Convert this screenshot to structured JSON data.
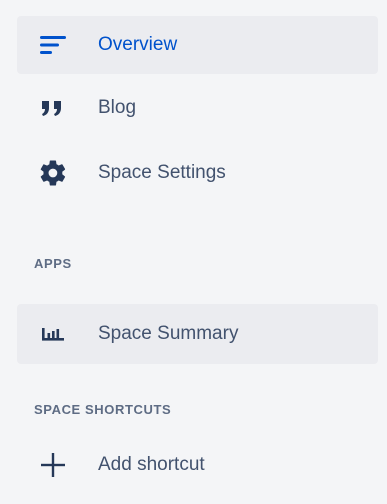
{
  "nav": {
    "items": [
      {
        "label": "Overview",
        "icon": "overview-icon"
      },
      {
        "label": "Blog",
        "icon": "quote-icon"
      },
      {
        "label": "Space Settings",
        "icon": "gear-icon"
      }
    ]
  },
  "apps": {
    "heading": "APPS",
    "items": [
      {
        "label": "Space Summary",
        "icon": "bar-chart-icon"
      }
    ]
  },
  "shortcuts": {
    "heading": "SPACE SHORTCUTS",
    "add_label": "Add shortcut",
    "add_icon": "plus-icon"
  },
  "colors": {
    "accent": "#0052cc",
    "text": "#42526e",
    "icon": "#253858",
    "selected_bg": "#ebecf0",
    "sidebar_bg": "#f4f5f7"
  }
}
